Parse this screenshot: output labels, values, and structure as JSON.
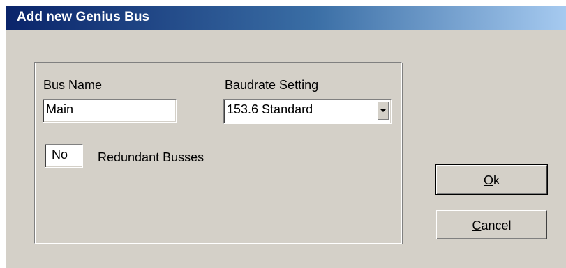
{
  "window": {
    "title": "Add new Genius Bus"
  },
  "form": {
    "bus_name_label": "Bus Name",
    "bus_name_value": "Main",
    "baudrate_label": "Baudrate Setting",
    "baudrate_value": "153.6 Standard",
    "redundant_value": "No",
    "redundant_label": "Redundant Busses"
  },
  "buttons": {
    "ok_mnemonic": "O",
    "ok_rest": "k",
    "cancel_mnemonic": "C",
    "cancel_rest": "ancel"
  },
  "colors": {
    "dialog_face": "#d4d0c8",
    "title_gradient_start": "#0a246a",
    "title_gradient_end": "#a6caf0"
  },
  "icons": {
    "combo_dropdown": "chevron-down-icon"
  }
}
